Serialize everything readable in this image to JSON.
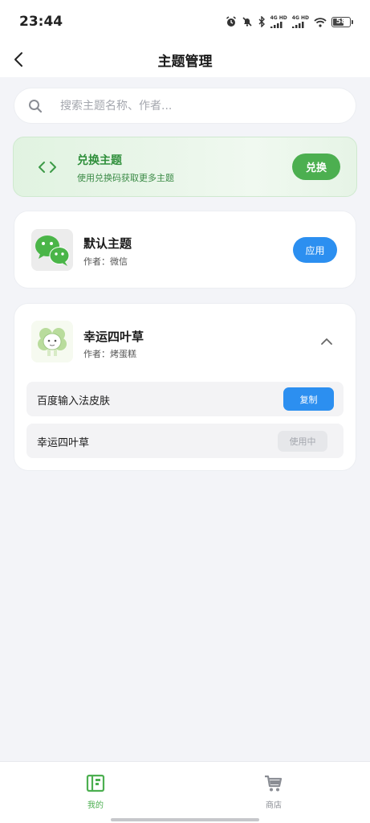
{
  "status_bar": {
    "time": "23:44",
    "network1": "4G HD",
    "network2": "4G HD",
    "battery": "58",
    "icons": [
      "alarm-icon",
      "mute-icon",
      "bluetooth-icon",
      "signal-icon",
      "signal-icon",
      "wifi-icon",
      "battery-icon"
    ]
  },
  "nav": {
    "title": "主题管理",
    "back_icon": "chevron-left-icon"
  },
  "search": {
    "placeholder": "搜索主题名称、作者...",
    "value": ""
  },
  "redeem": {
    "title": "兑换主题",
    "subtitle": "使用兑换码获取更多主题",
    "button": "兑换",
    "icon": "code-brackets-icon"
  },
  "themes": [
    {
      "name": "默认主题",
      "author": "作者：微信",
      "action": "应用",
      "thumb": "wechat-logo"
    },
    {
      "name": "幸运四叶草",
      "author": "作者：烤蛋糕",
      "thumb": "clover-character",
      "expanded": true,
      "sub_items": [
        {
          "label": "百度输入法皮肤",
          "action": "复制"
        },
        {
          "label": "幸运四叶草",
          "action": "使用中"
        }
      ]
    }
  ],
  "tabs": [
    {
      "label": "我的",
      "icon": "book-icon",
      "active": true
    },
    {
      "label": "商店",
      "icon": "cart-icon",
      "active": false
    }
  ],
  "colors": {
    "accent_green": "#4caf50",
    "accent_blue": "#2c8ff0",
    "background": "#f3f4f8",
    "inactive_gray": "#8a8d94"
  }
}
